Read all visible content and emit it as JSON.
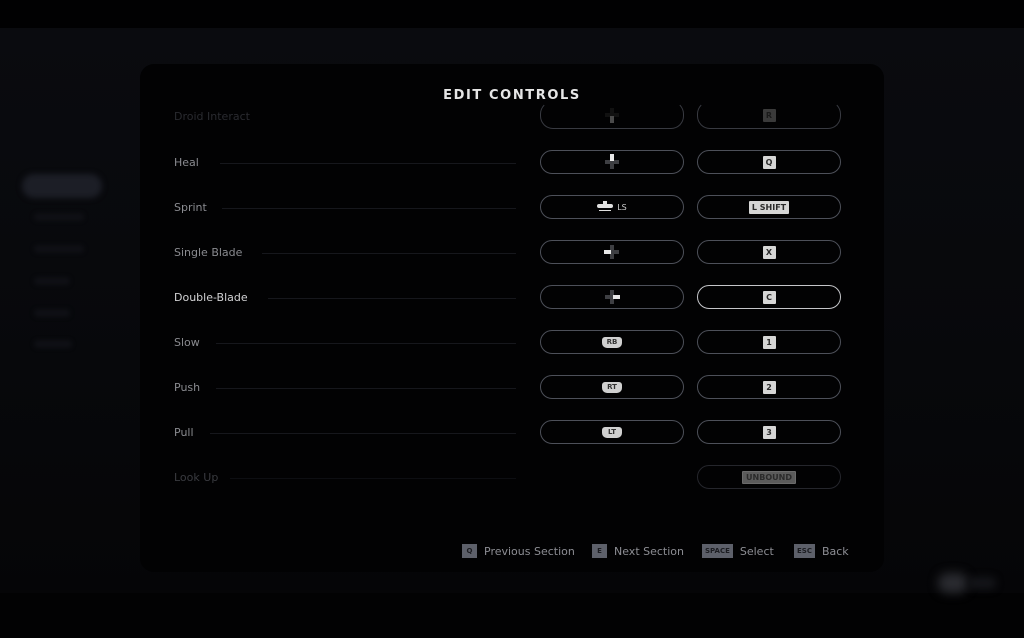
{
  "title": "EDIT CONTROLS",
  "colors": {
    "panel_bg": "#020203",
    "slot_border": "#4d5059",
    "slot_border_active": "#c4c5c9",
    "key_bg": "#d6d6d6",
    "label_text": "#8a8b90",
    "label_selected": "#d2d2d4"
  },
  "rows": [
    {
      "label": "Droid Interact",
      "gamepad": {
        "type": "dpad",
        "icon": "dpad-down-icon"
      },
      "keyboard": "R",
      "state": "faded"
    },
    {
      "label": "Heal",
      "gamepad": {
        "type": "dpad",
        "icon": "dpad-up-icon"
      },
      "keyboard": "Q",
      "state": "normal"
    },
    {
      "label": "Sprint",
      "gamepad": {
        "type": "stick",
        "icon": "left-stick-click-icon",
        "text": "LS"
      },
      "keyboard": "L SHIFT",
      "state": "normal"
    },
    {
      "label": "Single Blade",
      "gamepad": {
        "type": "dpad",
        "icon": "dpad-left-icon"
      },
      "keyboard": "X",
      "state": "normal"
    },
    {
      "label": "Double-Blade",
      "gamepad": {
        "type": "dpad",
        "icon": "dpad-right-icon"
      },
      "keyboard": "C",
      "state": "selected"
    },
    {
      "label": "Slow",
      "gamepad": {
        "type": "button",
        "text": "RB"
      },
      "keyboard": "1",
      "state": "normal"
    },
    {
      "label": "Push",
      "gamepad": {
        "type": "button",
        "text": "RT"
      },
      "keyboard": "2",
      "state": "normal"
    },
    {
      "label": "Pull",
      "gamepad": {
        "type": "button",
        "text": "LT"
      },
      "keyboard": "3",
      "state": "normal"
    },
    {
      "label": "Look Up",
      "gamepad": null,
      "keyboard": "UNBOUND",
      "state": "dim"
    }
  ],
  "footer": {
    "hints": [
      {
        "key": "Q",
        "label": "Previous Section"
      },
      {
        "key": "E",
        "label": "Next Section"
      },
      {
        "key": "SPACE",
        "label": "Select"
      },
      {
        "key": "ESC",
        "label": "Back"
      }
    ]
  }
}
